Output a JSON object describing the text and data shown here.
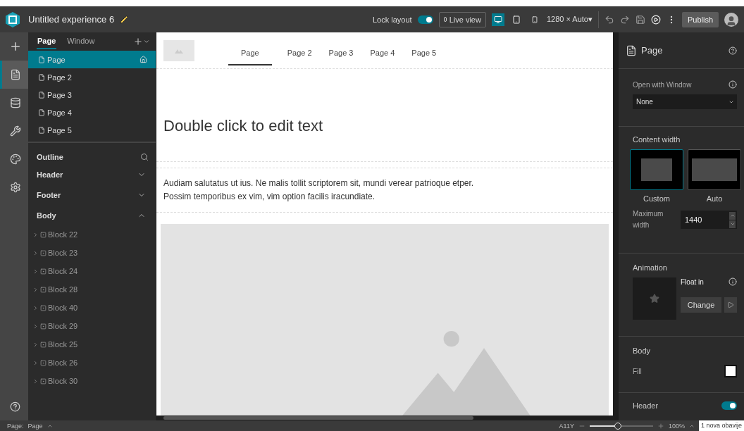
{
  "header": {
    "app_title": "Untitled experience 6",
    "lock_layout": {
      "label": "Lock layout",
      "on": true
    },
    "live_view": {
      "label": "Live view",
      "on": false
    },
    "devices": [
      {
        "kind": "desktop",
        "selected": true
      },
      {
        "kind": "tablet",
        "selected": false
      },
      {
        "kind": "phone",
        "selected": false
      }
    ],
    "resolution": "1280 × Auto▾",
    "publish": "Publish"
  },
  "rail": {
    "items": [
      {
        "kind": "pages",
        "selected": true
      },
      {
        "kind": "data",
        "selected": false
      },
      {
        "kind": "tools",
        "selected": false
      },
      {
        "kind": "theme",
        "selected": false
      },
      {
        "kind": "settings",
        "selected": false
      }
    ]
  },
  "pages_panel": {
    "tabs": [
      {
        "label": "Page",
        "selected": true
      },
      {
        "label": "Window",
        "selected": false
      }
    ],
    "pages": [
      {
        "label": "Page",
        "selected": true,
        "home": true
      },
      {
        "label": "Page 2",
        "selected": false,
        "home": false
      },
      {
        "label": "Page 3",
        "selected": false,
        "home": false
      },
      {
        "label": "Page 4",
        "selected": false,
        "home": false
      },
      {
        "label": "Page 5",
        "selected": false,
        "home": false
      }
    ]
  },
  "outline": {
    "title": "Outline",
    "sections": [
      {
        "label": "Header",
        "expanded": false
      },
      {
        "label": "Footer",
        "expanded": false
      },
      {
        "label": "Body",
        "expanded": true
      }
    ],
    "blocks": [
      "Block 22",
      "Block 23",
      "Block 24",
      "Block 28",
      "Block 40",
      "Block 29",
      "Block 25",
      "Block 26",
      "Block 30"
    ]
  },
  "canvas": {
    "nav": [
      {
        "label": "Page",
        "selected": true
      },
      {
        "label": "Page 2",
        "selected": false
      },
      {
        "label": "Page 3",
        "selected": false
      },
      {
        "label": "Page 4",
        "selected": false
      },
      {
        "label": "Page 5",
        "selected": false
      }
    ],
    "heading": "Double click to edit text",
    "paragraph_lines": [
      "Audiam salutatus ut ius. Ne malis tollit scriptorem sit, mundi verear patrioque etper.",
      "Possim temporibus ex vim, vim option facilis iracundiate."
    ]
  },
  "settings": {
    "title": "Page",
    "open_with_window": {
      "label": "Open with Window",
      "value": "None"
    },
    "content_width": {
      "label": "Content width",
      "options": [
        {
          "label": "Custom",
          "selected": true
        },
        {
          "label": "Auto",
          "selected": false
        }
      ],
      "max_label": "Maximum width",
      "max_value": "1440"
    },
    "animation": {
      "label": "Animation",
      "name": "Float in",
      "change": "Change"
    },
    "body": {
      "label": "Body",
      "fill_label": "Fill"
    },
    "header": {
      "label": "Header",
      "on": true
    }
  },
  "status": {
    "page_label": "Page:",
    "page_value": "Page",
    "a11y": "A11Y",
    "zoom": {
      "level": 0.45,
      "reading": "100%"
    },
    "notification": "1 nova obavije"
  }
}
